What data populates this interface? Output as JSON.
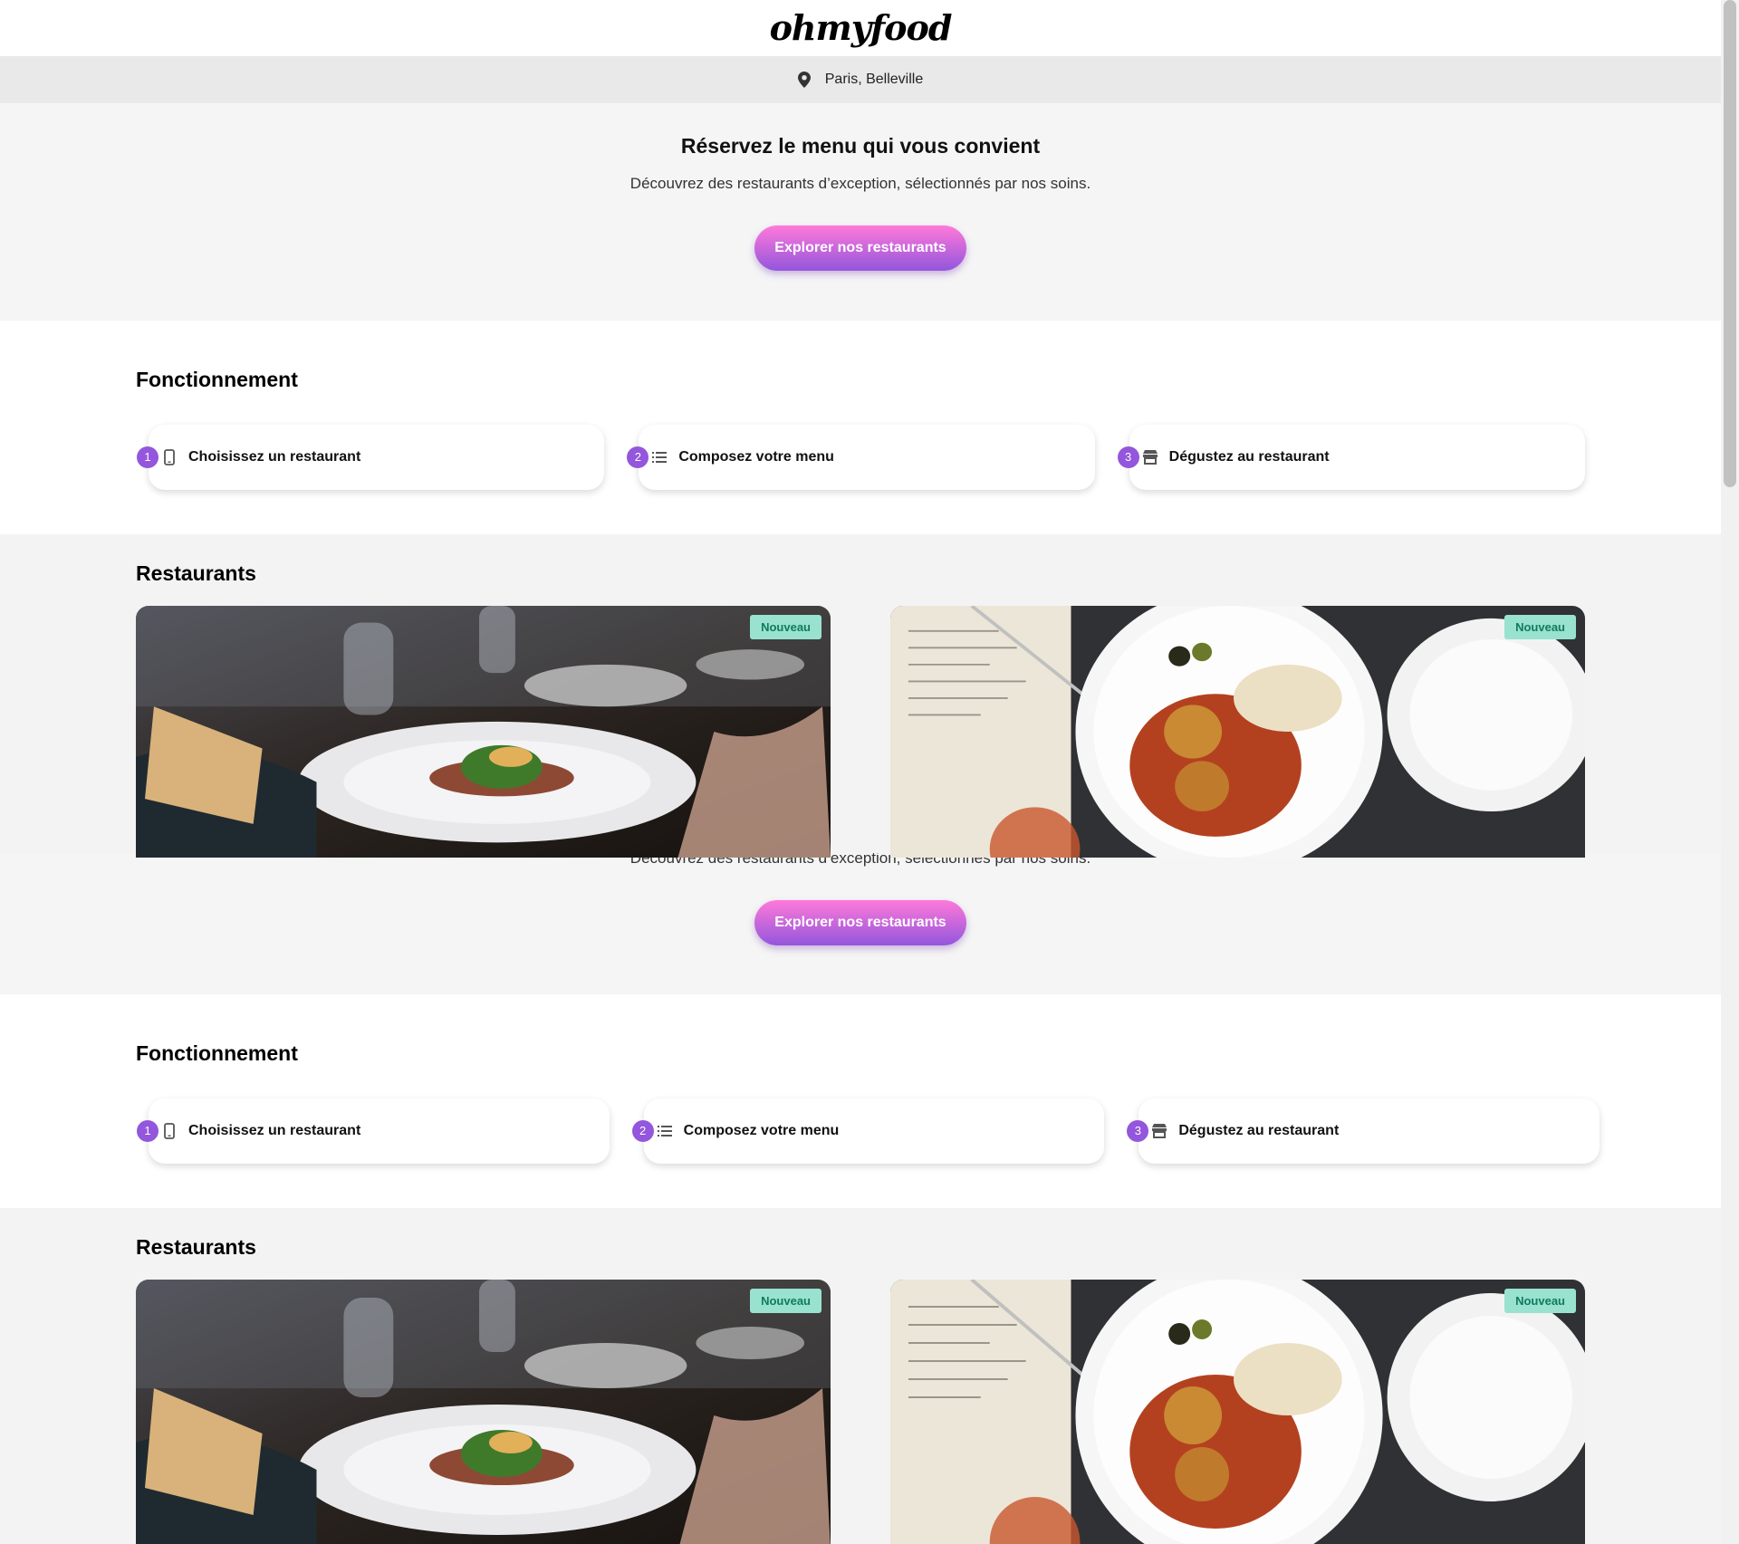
{
  "header": {
    "logo": "ohmyfood"
  },
  "location": {
    "text": "Paris, Belleville",
    "icon": "map-pin-icon"
  },
  "hero": {
    "title": "Réservez le menu qui vous convient",
    "subtitle": "Découvrez des restaurants d’exception, sélectionnés par nos soins.",
    "cta": "Explorer nos restaurants"
  },
  "how": {
    "title": "Fonctionnement",
    "steps": [
      {
        "num": "1",
        "label": "Choisissez un restaurant",
        "icon": "phone-icon"
      },
      {
        "num": "2",
        "label": "Composez votre menu",
        "icon": "list-icon"
      },
      {
        "num": "3",
        "label": "Dégustez au restaurant",
        "icon": "store-icon"
      }
    ]
  },
  "restaurants": {
    "title": "Restaurants",
    "cards": [
      {
        "badge": "Nouveau"
      },
      {
        "badge": "Nouveau"
      }
    ]
  },
  "colors": {
    "accent_start": "#ff79da",
    "accent_end": "#9356dc",
    "badge_bg": "#99e2d0",
    "badge_text": "#117a5f"
  }
}
